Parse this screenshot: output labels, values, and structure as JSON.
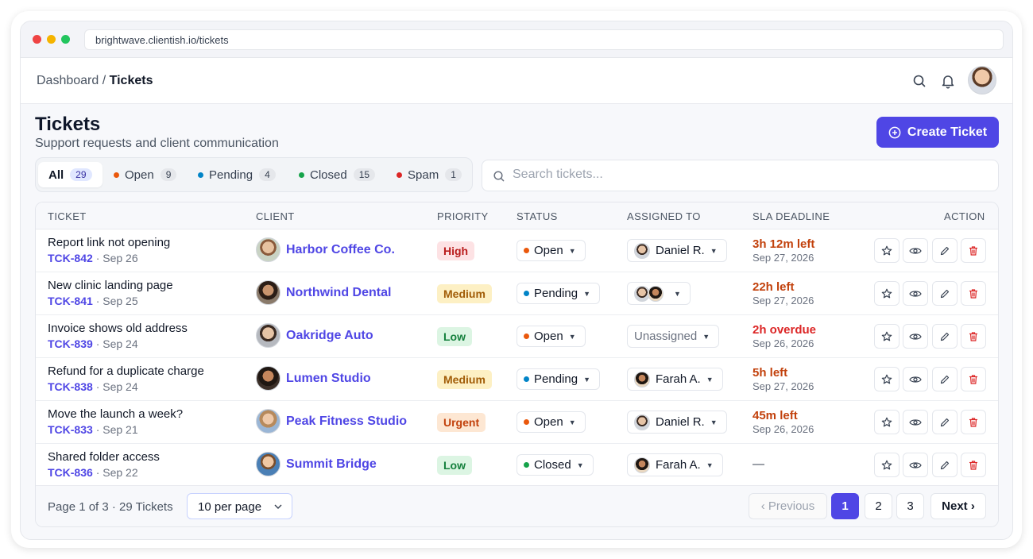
{
  "browser": {
    "url": "brightwave.clientish.io/tickets"
  },
  "breadcrumb": {
    "root": "Dashboard",
    "separator": " / ",
    "current": "Tickets"
  },
  "header": {
    "search_icon": "search-icon",
    "bell_icon": "bell-icon"
  },
  "page": {
    "title": "Tickets",
    "subtitle": "Support requests and client communication",
    "create_label": "Create Ticket"
  },
  "tabs": [
    {
      "label": "All",
      "count": "29",
      "active": true,
      "dot_color": ""
    },
    {
      "label": "Open",
      "count": "9",
      "active": false,
      "dot_color": "#ea580c"
    },
    {
      "label": "Pending",
      "count": "4",
      "active": false,
      "dot_color": "#0284c7"
    },
    {
      "label": "Closed",
      "count": "15",
      "active": false,
      "dot_color": "#16a34a"
    },
    {
      "label": "Spam",
      "count": "1",
      "active": false,
      "dot_color": "#dc2626"
    }
  ],
  "search": {
    "placeholder": "Search tickets..."
  },
  "columns": {
    "ticket": "TICKET",
    "client": "CLIENT",
    "priority": "PRIORITY",
    "status": "STATUS",
    "assigned": "ASSIGNED TO",
    "sla": "SLA DEADLINE",
    "action": "ACTION"
  },
  "rows": [
    {
      "title": "Report link not opening",
      "id": "TCK-842",
      "date": "· Sep 26",
      "client": "Harbor Coffee Co.",
      "priority": "High",
      "status": "Open",
      "assignee": "Daniel R.",
      "sla": "3h 12m left",
      "sla_date": "Sep 27, 2026"
    },
    {
      "title": "New clinic landing page",
      "id": "TCK-841",
      "date": "· Sep 25",
      "client": "Northwind Dental",
      "priority": "Medium",
      "status": "Pending",
      "assignee": "",
      "sla": "22h left",
      "sla_date": "Sep 27, 2026"
    },
    {
      "title": "Invoice shows old address",
      "id": "TCK-839",
      "date": "· Sep 24",
      "client": "Oakridge Auto",
      "priority": "Low",
      "status": "Open",
      "assignee": "Unassigned",
      "sla": "2h overdue",
      "sla_date": "Sep 26, 2026"
    },
    {
      "title": "Refund for a duplicate charge",
      "id": "TCK-838",
      "date": "· Sep 24",
      "client": "Lumen Studio",
      "priority": "Medium",
      "status": "Pending",
      "assignee": "Farah A.",
      "sla": "5h left",
      "sla_date": "Sep 27, 2026"
    },
    {
      "title": "Move the launch a week?",
      "id": "TCK-833",
      "date": "· Sep 21",
      "client": "Peak Fitness Studio",
      "priority": "Urgent",
      "status": "Open",
      "assignee": "Daniel R.",
      "sla": "45m left",
      "sla_date": "Sep 26, 2026"
    },
    {
      "title": "Shared folder access",
      "id": "TCK-836",
      "date": "· Sep 22",
      "client": "Summit Bridge",
      "priority": "Low",
      "status": "Closed",
      "assignee": "Farah A.",
      "sla": "—",
      "sla_date": ""
    }
  ],
  "colors": {
    "accent": "#4f46e5",
    "priority": {
      "High": [
        "#fde2e4",
        "#b91c1c"
      ],
      "Medium": [
        "#fdf0c4",
        "#a15c07"
      ],
      "Low": [
        "#dcf5e3",
        "#15803d"
      ],
      "Urgent": [
        "#fde7d3",
        "#c2410c"
      ]
    },
    "status": {
      "Open": "#ea580c",
      "Pending": "#0284c7",
      "Closed": "#16a34a"
    },
    "sla": {
      "3h 12m left": "#c2410c",
      "22h left": "#c2410c",
      "2h overdue": "#dc2626",
      "5h left": "#c2410c",
      "45m left": "#c2410c",
      "—": "#374151"
    }
  },
  "footer": {
    "page_info": "Page 1 of 3 · 29 Tickets",
    "per_page": "10 per page",
    "previous": "‹ Previous",
    "pages": [
      "1",
      "2",
      "3"
    ],
    "current_page": "1",
    "next": "Next ›"
  }
}
